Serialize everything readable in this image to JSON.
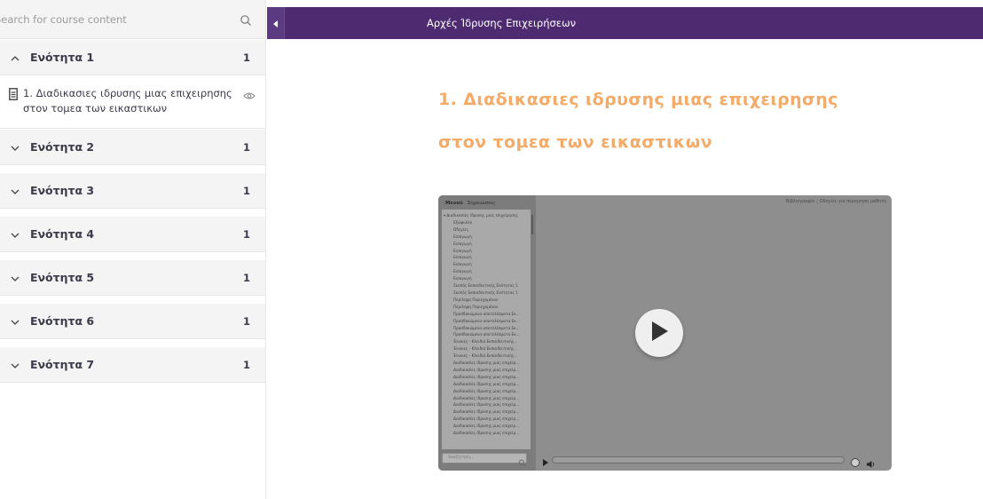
{
  "sidebar": {
    "search": {
      "placeholder": "Search for course content"
    },
    "sections": [
      {
        "title": "Ενότητα 1",
        "count": "1",
        "expanded": true
      },
      {
        "title": "Ενότητα 2",
        "count": "1",
        "expanded": false
      },
      {
        "title": "Ενότητα 3",
        "count": "1",
        "expanded": false
      },
      {
        "title": "Ενότητα 4",
        "count": "1",
        "expanded": false
      },
      {
        "title": "Ενότητα 5",
        "count": "1",
        "expanded": false
      },
      {
        "title": "Ενότητα 6",
        "count": "1",
        "expanded": false
      },
      {
        "title": "Ενότητα 7",
        "count": "1",
        "expanded": false
      }
    ],
    "lesson": {
      "title": "1. Διαδικασιες ιδρυσης μιας επιχειρησης στον τομεα των εικαστικων"
    }
  },
  "header": {
    "title": "Αρχές Ίδρυσης Επιχειρήσεων"
  },
  "main": {
    "title": "1. Διαδικασιες ιδρυσης μιας επιχειρησης στον τομεα των εικαστικων",
    "player": {
      "tabs": [
        "Μενού",
        "Σημειώσεις"
      ],
      "links": [
        "Βιβλιογραφία",
        "Οδηγίες για περιηγηση μαθητή"
      ],
      "search_placeholder": "Αναζήτηση...",
      "menu_items": [
        "Διαδικασίες ίδρυσης μιας επιχείρησης",
        "Εξώφυλλο",
        "Οδηγίες",
        "Εισαγωγή",
        "Εισαγωγή",
        "Εισαγωγή",
        "Εισαγωγή",
        "Εισαγωγή",
        "Εισαγωγή",
        "Εισαγωγή",
        "Σκοπός Εκπαιδευτικής Ενότητας 1",
        "Σκοπός Εκπαιδευτικής Ενότητας 1",
        "Περίληψη Περιεχομένου",
        "Περίληψη Περιεχομένου",
        "Προσδοκώμενα αποτελέσματα Εκ...",
        "Προσδοκώμενα αποτελέσματα Εκ...",
        "Προσδοκώμενα αποτελέσματα Εκ...",
        "Προσδοκώμενα αποτελέσματα Εκ...",
        "Έννοιες - Κλειδιά Εκπαιδευτικής...",
        "Έννοιες - Κλειδιά Εκπαιδευτικής...",
        "Έννοιες - Κλειδιά Εκπαιδευτικής...",
        "Διαδικασίες ίδρυσης μιας επιχείρ...",
        "Διαδικασίες ίδρυσης μιας επιχείρ...",
        "Διαδικασίες ίδρυσης μιας επιχείρ...",
        "Διαδικασίες ίδρυσης μιας επιχείρ...",
        "Διαδικασίες ίδρυσης μιας επιχείρ...",
        "Διαδικασίες ίδρυσης μιας επιχείρ...",
        "Διαδικασίες ίδρυσης μιας επιχείρ...",
        "Διαδικασίες ίδρυσης μιας επιχείρ...",
        "Διαδικασίες ίδρυσης μιας επιχείρ...",
        "Διαδικασίες ίδρυσης μιας επιχείρ...",
        "Διαδικασίες ίδρυσης μιας επιχείρ..."
      ]
    }
  },
  "colors": {
    "header_bg": "#4e2b71",
    "title_accent": "#f3ab6a",
    "sidebar_bg": "#f4f4f5"
  },
  "icons": [
    "search-icon",
    "chevron-up-icon",
    "chevron-down-icon",
    "document-icon",
    "eye-icon",
    "caret-left-icon",
    "play-icon",
    "volume-icon"
  ]
}
